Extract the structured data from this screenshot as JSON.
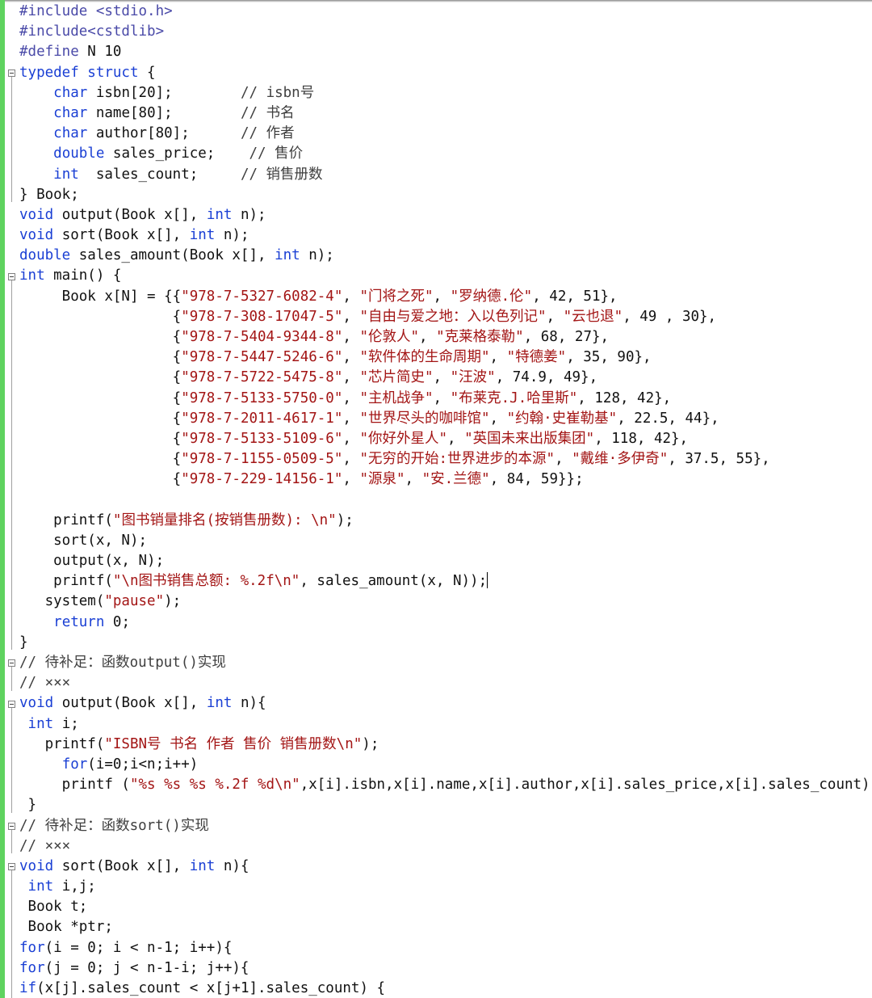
{
  "editor": {
    "language": "c",
    "colors": {
      "keyword": "#1a3fd4",
      "string": "#a31515",
      "comment": "#3f3f3f",
      "preprocessor": "#4a4aa8",
      "change_bar": "#5fd35f"
    },
    "lines": [
      [
        {
          "t": "pp",
          "v": "#include <stdio.h>"
        }
      ],
      [
        {
          "t": "pp",
          "v": "#include<cstdlib>"
        }
      ],
      [
        {
          "t": "pp",
          "v": "#define "
        },
        {
          "t": "p",
          "v": "N 10"
        }
      ],
      [
        {
          "t": "kw",
          "v": "typedef struct"
        },
        {
          "t": "p",
          "v": " {"
        }
      ],
      [
        {
          "t": "p",
          "v": "    "
        },
        {
          "t": "kw",
          "v": "char"
        },
        {
          "t": "p",
          "v": " isbn[20];        "
        },
        {
          "t": "cmt",
          "v": "// isbn号"
        }
      ],
      [
        {
          "t": "p",
          "v": "    "
        },
        {
          "t": "kw",
          "v": "char"
        },
        {
          "t": "p",
          "v": " name[80];        "
        },
        {
          "t": "cmt",
          "v": "// 书名"
        }
      ],
      [
        {
          "t": "p",
          "v": "    "
        },
        {
          "t": "kw",
          "v": "char"
        },
        {
          "t": "p",
          "v": " author[80];      "
        },
        {
          "t": "cmt",
          "v": "// 作者"
        }
      ],
      [
        {
          "t": "p",
          "v": "    "
        },
        {
          "t": "kw",
          "v": "double"
        },
        {
          "t": "p",
          "v": " sales_price;    "
        },
        {
          "t": "cmt",
          "v": "// 售价"
        }
      ],
      [
        {
          "t": "p",
          "v": "    "
        },
        {
          "t": "kw",
          "v": "int"
        },
        {
          "t": "p",
          "v": "  sales_count;     "
        },
        {
          "t": "cmt",
          "v": "// 销售册数"
        }
      ],
      [
        {
          "t": "p",
          "v": "} Book;"
        }
      ],
      [
        {
          "t": "kw",
          "v": "void"
        },
        {
          "t": "p",
          "v": " output(Book x[], "
        },
        {
          "t": "kw",
          "v": "int"
        },
        {
          "t": "p",
          "v": " n);"
        }
      ],
      [
        {
          "t": "kw",
          "v": "void"
        },
        {
          "t": "p",
          "v": " sort(Book x[], "
        },
        {
          "t": "kw",
          "v": "int"
        },
        {
          "t": "p",
          "v": " n);"
        }
      ],
      [
        {
          "t": "kw",
          "v": "double"
        },
        {
          "t": "p",
          "v": " sales_amount(Book x[], "
        },
        {
          "t": "kw",
          "v": "int"
        },
        {
          "t": "p",
          "v": " n);"
        }
      ],
      [
        {
          "t": "kw",
          "v": "int"
        },
        {
          "t": "p",
          "v": " main() {"
        }
      ],
      [
        {
          "t": "p",
          "v": "     Book x[N] = {{"
        },
        {
          "t": "str",
          "v": "\"978-7-5327-6082-4\""
        },
        {
          "t": "p",
          "v": ", "
        },
        {
          "t": "str",
          "v": "\"门将之死\""
        },
        {
          "t": "p",
          "v": ", "
        },
        {
          "t": "str",
          "v": "\"罗纳德.伦\""
        },
        {
          "t": "p",
          "v": ", 42, 51},"
        }
      ],
      [
        {
          "t": "p",
          "v": "                  {"
        },
        {
          "t": "str",
          "v": "\"978-7-308-17047-5\""
        },
        {
          "t": "p",
          "v": ", "
        },
        {
          "t": "str",
          "v": "\"自由与爱之地：入以色列记\""
        },
        {
          "t": "p",
          "v": ", "
        },
        {
          "t": "str",
          "v": "\"云也退\""
        },
        {
          "t": "p",
          "v": ", 49 , 30},"
        }
      ],
      [
        {
          "t": "p",
          "v": "                  {"
        },
        {
          "t": "str",
          "v": "\"978-7-5404-9344-8\""
        },
        {
          "t": "p",
          "v": ", "
        },
        {
          "t": "str",
          "v": "\"伦敦人\""
        },
        {
          "t": "p",
          "v": ", "
        },
        {
          "t": "str",
          "v": "\"克莱格泰勒\""
        },
        {
          "t": "p",
          "v": ", 68, 27},"
        }
      ],
      [
        {
          "t": "p",
          "v": "                  {"
        },
        {
          "t": "str",
          "v": "\"978-7-5447-5246-6\""
        },
        {
          "t": "p",
          "v": ", "
        },
        {
          "t": "str",
          "v": "\"软件体的生命周期\""
        },
        {
          "t": "p",
          "v": ", "
        },
        {
          "t": "str",
          "v": "\"特德姜\""
        },
        {
          "t": "p",
          "v": ", 35, 90},"
        }
      ],
      [
        {
          "t": "p",
          "v": "                  {"
        },
        {
          "t": "str",
          "v": "\"978-7-5722-5475-8\""
        },
        {
          "t": "p",
          "v": ", "
        },
        {
          "t": "str",
          "v": "\"芯片简史\""
        },
        {
          "t": "p",
          "v": ", "
        },
        {
          "t": "str",
          "v": "\"汪波\""
        },
        {
          "t": "p",
          "v": ", 74.9, 49},"
        }
      ],
      [
        {
          "t": "p",
          "v": "                  {"
        },
        {
          "t": "str",
          "v": "\"978-7-5133-5750-0\""
        },
        {
          "t": "p",
          "v": ", "
        },
        {
          "t": "str",
          "v": "\"主机战争\""
        },
        {
          "t": "p",
          "v": ", "
        },
        {
          "t": "str",
          "v": "\"布莱克.J.哈里斯\""
        },
        {
          "t": "p",
          "v": ", 128, 42},"
        }
      ],
      [
        {
          "t": "p",
          "v": "                  {"
        },
        {
          "t": "str",
          "v": "\"978-7-2011-4617-1\""
        },
        {
          "t": "p",
          "v": ", "
        },
        {
          "t": "str",
          "v": "\"世界尽头的咖啡馆\""
        },
        {
          "t": "p",
          "v": ", "
        },
        {
          "t": "str",
          "v": "\"约翰·史崔勒基\""
        },
        {
          "t": "p",
          "v": ", 22.5, 44},"
        }
      ],
      [
        {
          "t": "p",
          "v": "                  {"
        },
        {
          "t": "str",
          "v": "\"978-7-5133-5109-6\""
        },
        {
          "t": "p",
          "v": ", "
        },
        {
          "t": "str",
          "v": "\"你好外星人\""
        },
        {
          "t": "p",
          "v": ", "
        },
        {
          "t": "str",
          "v": "\"英国未来出版集团\""
        },
        {
          "t": "p",
          "v": ", 118, 42},"
        }
      ],
      [
        {
          "t": "p",
          "v": "                  {"
        },
        {
          "t": "str",
          "v": "\"978-7-1155-0509-5\""
        },
        {
          "t": "p",
          "v": ", "
        },
        {
          "t": "str",
          "v": "\"无穷的开始:世界进步的本源\""
        },
        {
          "t": "p",
          "v": ", "
        },
        {
          "t": "str",
          "v": "\"戴维·多伊奇\""
        },
        {
          "t": "p",
          "v": ", 37.5, 55},"
        }
      ],
      [
        {
          "t": "p",
          "v": "                  {"
        },
        {
          "t": "str",
          "v": "\"978-7-229-14156-1\""
        },
        {
          "t": "p",
          "v": ", "
        },
        {
          "t": "str",
          "v": "\"源泉\""
        },
        {
          "t": "p",
          "v": ", "
        },
        {
          "t": "str",
          "v": "\"安.兰德\""
        },
        {
          "t": "p",
          "v": ", 84, 59}};"
        }
      ],
      [],
      [
        {
          "t": "p",
          "v": "    printf("
        },
        {
          "t": "str",
          "v": "\"图书销量排名(按销售册数): \\n\""
        },
        {
          "t": "p",
          "v": ");"
        }
      ],
      [
        {
          "t": "p",
          "v": "    sort(x, N);"
        }
      ],
      [
        {
          "t": "p",
          "v": "    output(x, N);"
        }
      ],
      [
        {
          "t": "p",
          "v": "    printf("
        },
        {
          "t": "str",
          "v": "\"\\n图书销售总额: %.2f\\n\""
        },
        {
          "t": "p",
          "v": ", sales_amount(x, N));"
        },
        {
          "t": "caret",
          "v": ""
        }
      ],
      [
        {
          "t": "p",
          "v": "   system("
        },
        {
          "t": "str",
          "v": "\"pause\""
        },
        {
          "t": "p",
          "v": ");"
        }
      ],
      [
        {
          "t": "p",
          "v": "    "
        },
        {
          "t": "kw",
          "v": "return"
        },
        {
          "t": "p",
          "v": " 0;"
        }
      ],
      [
        {
          "t": "p",
          "v": "}"
        }
      ],
      [
        {
          "t": "cmt",
          "v": "// 待补足：函数output()实现"
        }
      ],
      [
        {
          "t": "cmt",
          "v": "// ×××"
        }
      ],
      [
        {
          "t": "kw",
          "v": "void"
        },
        {
          "t": "p",
          "v": " output(Book x[], "
        },
        {
          "t": "kw",
          "v": "int"
        },
        {
          "t": "p",
          "v": " n){"
        }
      ],
      [
        {
          "t": "p",
          "v": " "
        },
        {
          "t": "kw",
          "v": "int"
        },
        {
          "t": "p",
          "v": " i;"
        }
      ],
      [
        {
          "t": "p",
          "v": "   printf("
        },
        {
          "t": "str",
          "v": "\"ISBN号 书名 作者 售价 销售册数\\n\""
        },
        {
          "t": "p",
          "v": ");"
        }
      ],
      [
        {
          "t": "p",
          "v": "     "
        },
        {
          "t": "kw",
          "v": "for"
        },
        {
          "t": "p",
          "v": "(i=0;i<n;i++)"
        }
      ],
      [
        {
          "t": "p",
          "v": "     printf ("
        },
        {
          "t": "str",
          "v": "\"%s %s %s %.2f %d\\n\""
        },
        {
          "t": "p",
          "v": ",x[i].isbn,x[i].name,x[i].author,x[i].sales_price,x[i].sales_count);"
        }
      ],
      [
        {
          "t": "p",
          "v": " }"
        }
      ],
      [
        {
          "t": "cmt",
          "v": "// 待补足：函数sort()实现"
        }
      ],
      [
        {
          "t": "cmt",
          "v": "// ×××"
        }
      ],
      [
        {
          "t": "kw",
          "v": "void"
        },
        {
          "t": "p",
          "v": " sort(Book x[], "
        },
        {
          "t": "kw",
          "v": "int"
        },
        {
          "t": "p",
          "v": " n){"
        }
      ],
      [
        {
          "t": "p",
          "v": " "
        },
        {
          "t": "kw",
          "v": "int"
        },
        {
          "t": "p",
          "v": " i,j;"
        }
      ],
      [
        {
          "t": "p",
          "v": " Book t;"
        }
      ],
      [
        {
          "t": "p",
          "v": " Book *ptr;"
        }
      ],
      [
        {
          "t": "kw",
          "v": "for"
        },
        {
          "t": "p",
          "v": "(i = 0; i < n-1; i++){"
        }
      ],
      [
        {
          "t": "kw",
          "v": "for"
        },
        {
          "t": "p",
          "v": "(j = 0; j < n-1-i; j++){"
        }
      ],
      [
        {
          "t": "kw",
          "v": "if"
        },
        {
          "t": "p",
          "v": "(x[j].sales_count < x[j+1].sales_count) {"
        }
      ]
    ]
  }
}
